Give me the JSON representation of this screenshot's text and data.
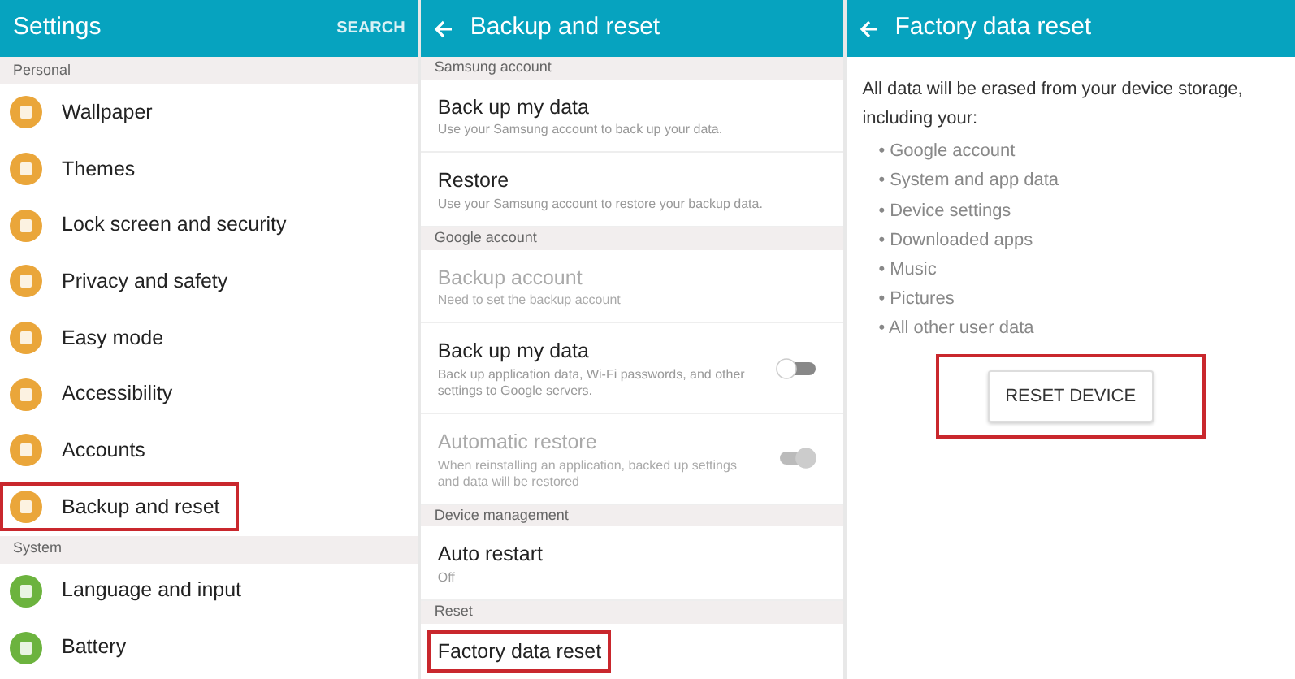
{
  "panels": [
    {
      "kind": "settings",
      "title": "Settings",
      "action": "SEARCH",
      "back": false,
      "sections": [
        {
          "header": "Personal",
          "items": [
            {
              "label": "Wallpaper",
              "color": "#eaa63a",
              "highlighted": false
            },
            {
              "label": "Themes",
              "color": "#eaa63a",
              "highlighted": false
            },
            {
              "label": "Lock screen and security",
              "color": "#eaa63a",
              "highlighted": false
            },
            {
              "label": "Privacy and safety",
              "color": "#eaa63a",
              "highlighted": false
            },
            {
              "label": "Easy mode",
              "color": "#eaa63a",
              "highlighted": false
            },
            {
              "label": "Accessibility",
              "color": "#eaa63a",
              "highlighted": false
            },
            {
              "label": "Accounts",
              "color": "#eaa63a",
              "highlighted": false
            },
            {
              "label": "Backup and reset",
              "color": "#eaa63a",
              "highlighted": true
            }
          ]
        },
        {
          "header": "System",
          "items": [
            {
              "label": "Language and input",
              "color": "#6cb33e",
              "highlighted": false
            },
            {
              "label": "Battery",
              "color": "#6cb33e",
              "highlighted": false
            }
          ]
        }
      ]
    },
    {
      "kind": "backup",
      "title": "Backup and reset",
      "back": true,
      "sections": [
        {
          "header": "Samsung account",
          "items": [
            {
              "title": "Back up my data",
              "subtitle": "Use your Samsung account to back up your data.",
              "disabled": false,
              "highlighted": false
            },
            {
              "title": "Restore",
              "subtitle": "Use your Samsung account to restore your backup data.",
              "disabled": false,
              "highlighted": false
            }
          ]
        },
        {
          "header": "Google account",
          "items": [
            {
              "title": "Backup account",
              "subtitle": "Need to set the backup account",
              "disabled": true,
              "highlighted": false
            },
            {
              "title": "Back up my data",
              "subtitle": "Back up application data, Wi-Fi passwords, and other settings to Google servers.",
              "disabled": false,
              "highlighted": false,
              "toggle": {
                "on": false
              }
            },
            {
              "title": "Automatic restore",
              "subtitle": "When reinstalling an application, backed up settings and data will be restored",
              "disabled": true,
              "highlighted": false,
              "toggle": {
                "on": true
              }
            }
          ]
        },
        {
          "header": "Device management",
          "items": [
            {
              "title": "Auto restart",
              "subtitle": "Off",
              "disabled": false,
              "highlighted": false
            }
          ]
        },
        {
          "header": "Reset",
          "items": [
            {
              "title": "Factory data reset",
              "disabled": false,
              "highlighted": true
            }
          ]
        }
      ]
    },
    {
      "kind": "reset",
      "title": "Factory data reset",
      "back": true,
      "intro": "All data will be erased from your device storage, including your:",
      "bullets": [
        "• Google account",
        "• System and app data",
        "• Device settings",
        "• Downloaded apps",
        "• Music",
        "• Pictures",
        "• All other user data"
      ],
      "button": {
        "label": "RESET DEVICE",
        "highlighted": true
      }
    }
  ]
}
